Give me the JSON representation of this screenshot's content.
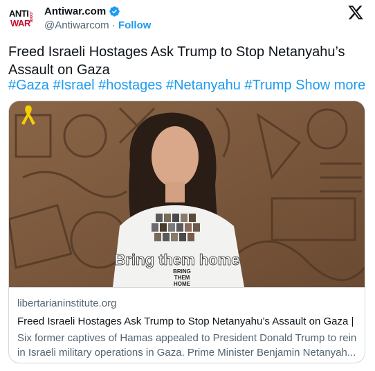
{
  "author": {
    "name": "Antiwar.com",
    "handle": "@Antiwarcom",
    "separator": "·",
    "follow_label": "Follow",
    "avatar_text_1": "ANTI",
    "avatar_text_2": "WAR",
    "avatar_text_3": ".com"
  },
  "tweet": {
    "text": "Freed Israeli Hostages Ask Trump to Stop Netanyahu’s Assault on Gaza",
    "hashtags": [
      "#Gaza",
      "#Israel",
      "#hostages",
      "#Netanyahu",
      "#Trump"
    ],
    "show_more": "Show more"
  },
  "card": {
    "media_caption": "Bring them home",
    "shirt_text_1": "BRING",
    "shirt_text_2": "THEM",
    "shirt_text_3": "HOME",
    "domain": "libertarianinstitute.org",
    "title": "Freed Israeli Hostages Ask Trump to Stop Netanyahu’s Assault on Gaza | ...",
    "description": "Six former captives of Hamas appealed to President Donald Trump to rein in Israeli military operations in Gaza. Prime Minister Benjamin Netanyah..."
  },
  "colors": {
    "link": "#1d9bf0",
    "secondary_text": "#536471",
    "border": "#cfd9de",
    "verified": "#1d9bf0"
  },
  "icons": [
    "verified-badge-icon",
    "x-logo-icon",
    "yellow-ribbon-icon"
  ]
}
